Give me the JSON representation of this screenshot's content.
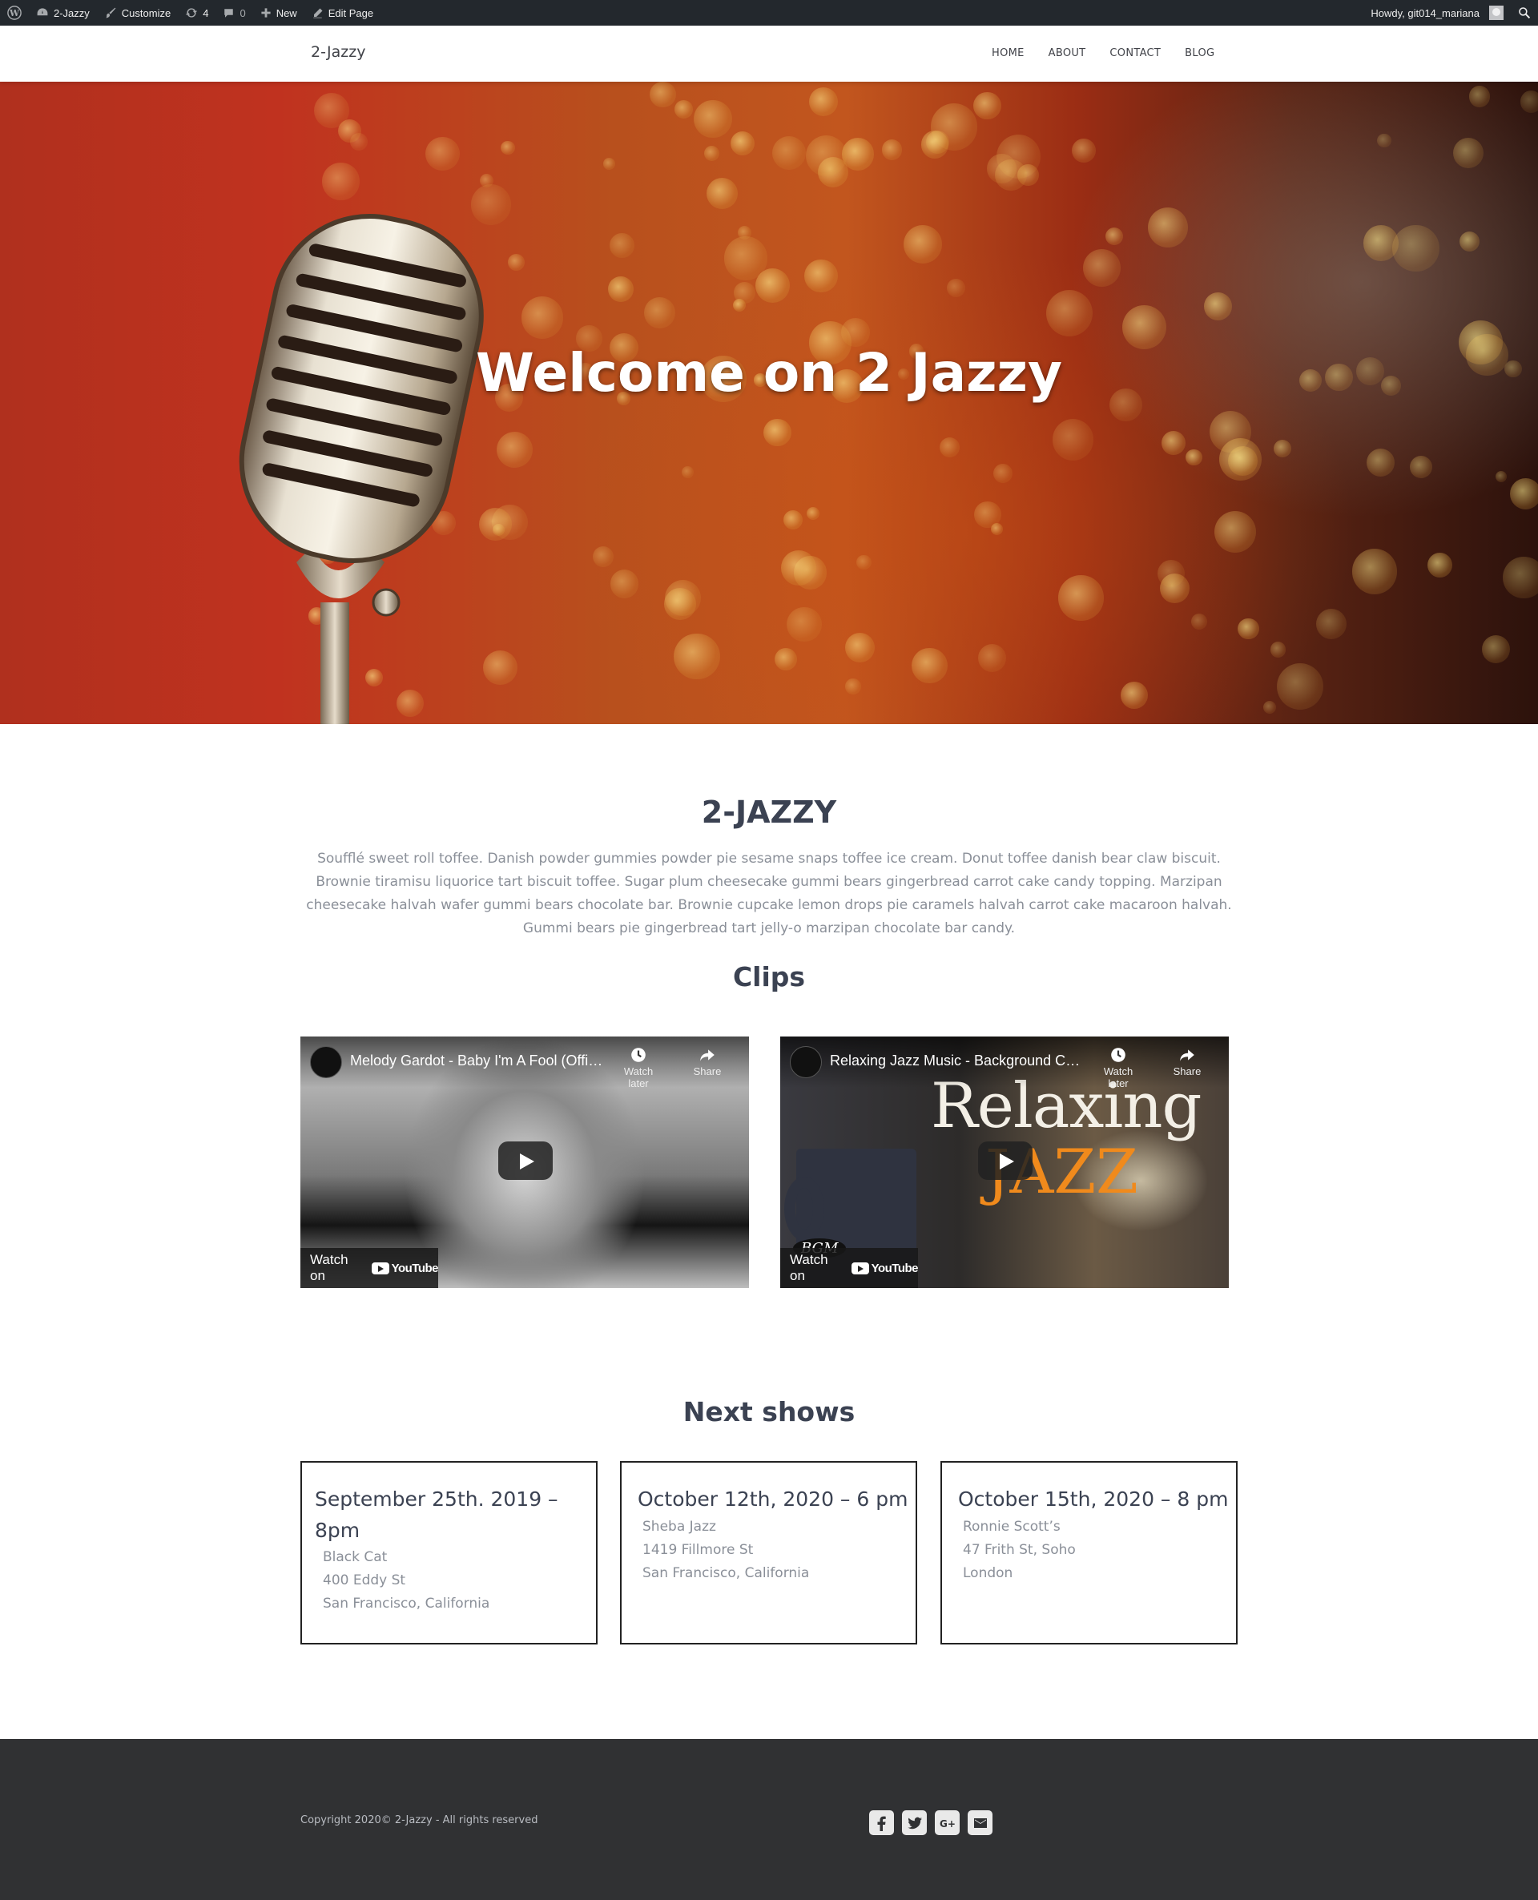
{
  "adminbar": {
    "site": "2-Jazzy",
    "customize": "Customize",
    "updates": "4",
    "comments": "0",
    "new": "New",
    "edit_page": "Edit Page",
    "howdy": "Howdy, git014_mariana"
  },
  "header": {
    "brand": "2-Jazzy",
    "nav": [
      "HOME",
      "ABOUT",
      "CONTACT",
      "BLOG"
    ]
  },
  "hero": {
    "title": "Welcome on 2 Jazzy"
  },
  "about": {
    "title": "2-JAZZY",
    "text": "Soufflé sweet roll toffee. Danish powder gummies powder pie sesame snaps toffee ice cream. Donut toffee danish bear claw biscuit. Brownie tiramisu liquorice tart biscuit toffee. Sugar plum cheesecake gummi bears gingerbread carrot cake candy topping. Marzipan cheesecake halvah wafer gummi bears chocolate bar. Brownie cupcake lemon drops pie caramels halvah carrot cake macaroon halvah. Gummi bears pie gingerbread tart jelly-o marzipan chocolate bar candy."
  },
  "clips": {
    "title": "Clips",
    "videos": [
      {
        "title": "Melody Gardot - Baby I'm A Fool (Offici...",
        "watch_later": "Watch later",
        "share": "Share",
        "watch_on": "Watch on",
        "yt": "YouTube"
      },
      {
        "title": "Relaxing Jazz Music - Background Chill...",
        "watch_later": "Watch later",
        "share": "Share",
        "watch_on": "Watch on",
        "yt": "YouTube",
        "overlay_line1": "Relaxing",
        "overlay_line2": "JAZZ",
        "badge": "BGM"
      }
    ]
  },
  "shows": {
    "title": "Next shows",
    "items": [
      {
        "date": "September 25th. 2019 – 8pm",
        "venue": "Black Cat",
        "street": "400 Eddy St",
        "city": "San Francisco, California"
      },
      {
        "date": "October 12th, 2020 – 6 pm",
        "venue": "Sheba Jazz",
        "street": "1419 Fillmore St",
        "city": "San Francisco, California"
      },
      {
        "date": "October 15th, 2020 – 8 pm",
        "venue": "Ronnie Scott’s",
        "street": "47 Frith St, Soho",
        "city": "London"
      }
    ]
  },
  "footer": {
    "copyright": "Copyright 2020© 2-Jazzy - All rights reserved",
    "social": [
      "facebook-icon",
      "twitter-icon",
      "google-plus-icon",
      "email-icon"
    ]
  },
  "colors": {
    "adminbar_bg": "#23282d",
    "heading": "#3b4252",
    "body_text": "#8a8f98",
    "footer_bg": "#303133",
    "hero_accent": "#c0321f"
  }
}
